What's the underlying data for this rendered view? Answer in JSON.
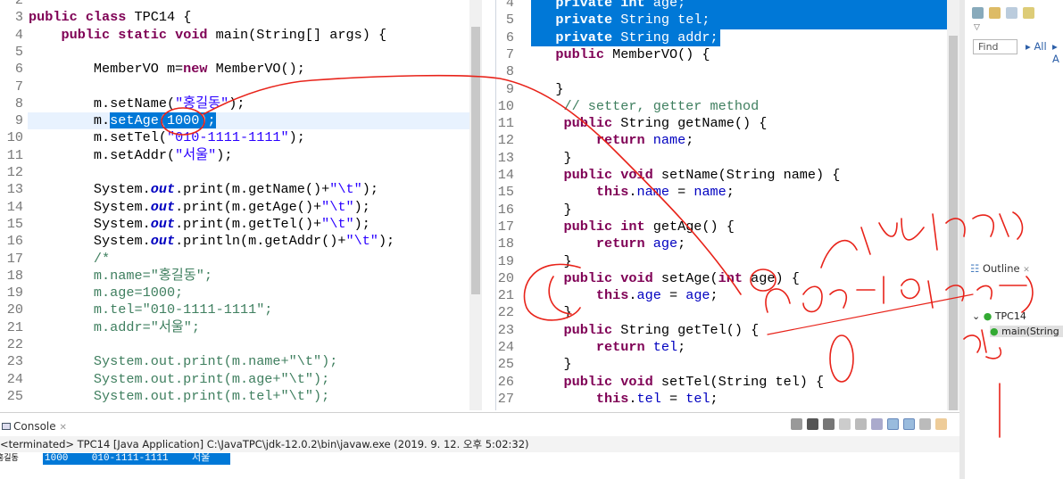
{
  "left_editor": {
    "first_line": 2,
    "current_line": 9,
    "selection": {
      "line": 9,
      "text": "setAge(1000);"
    },
    "lines": [
      "",
      "public class TPC14 {",
      "    public static void main(String[] args) {",
      "",
      "        MemberVO m=new MemberVO();",
      "",
      "        m.setName(\"홍길동\");",
      "        m.setAge(1000);",
      "        m.setTel(\"010-1111-1111\");",
      "        m.setAddr(\"서울\");",
      "",
      "        System.out.print(m.getName()+\"\\t\");",
      "        System.out.print(m.getAge()+\"\\t\");",
      "        System.out.print(m.getTel()+\"\\t\");",
      "        System.out.println(m.getAddr()+\"\\t\");",
      "        /*",
      "        m.name=\"홍길동\";",
      "        m.age=1000;",
      "        m.tel=\"010-1111-1111\";",
      "        m.addr=\"서울\";",
      "",
      "        System.out.print(m.name+\"\\t\");",
      "        System.out.print(m.age+\"\\t\");",
      "        System.out.print(m.tel+\"\\t\");"
    ]
  },
  "right_editor": {
    "first_line": 4,
    "selected_lines": [
      4,
      5,
      6
    ],
    "lines": [
      "   private int age;",
      "   private String tel;",
      "   private String addr;",
      "   public MemberVO() {",
      "",
      "   }",
      "    // setter, getter method",
      "    public String getName() {",
      "        return name;",
      "    }",
      "    public void setName(String name) {",
      "        this.name = name;",
      "    }",
      "    public int getAge() {",
      "        return age;",
      "    }",
      "    public void setAge(int age) {",
      "        this.age = age;",
      "    }",
      "    public String getTel() {",
      "        return tel;",
      "    }",
      "    public void setTel(String tel) {",
      "        this.tel = tel;"
    ]
  },
  "console": {
    "tab_label": "Console",
    "status": "<terminated> TPC14 [Java Application] C:\\JavaTPC\\jdk-12.0.2\\bin\\javaw.exe (2019. 9. 12. 오후 5:02:32)",
    "output_name": "홍길동",
    "output_selected": "1000    010-1111-1111    서울"
  },
  "side_panel": {
    "find_placeholder": "Find",
    "all_label": "All",
    "a_label": "A",
    "outline_label": "Outline",
    "tree_class": "TPC14",
    "tree_method": "main(String"
  },
  "colors": {
    "keyword": "#7f0055",
    "string": "#2a00ff",
    "comment": "#3f7f5f",
    "selection": "#0078d7",
    "annotation": "#e8231a"
  }
}
